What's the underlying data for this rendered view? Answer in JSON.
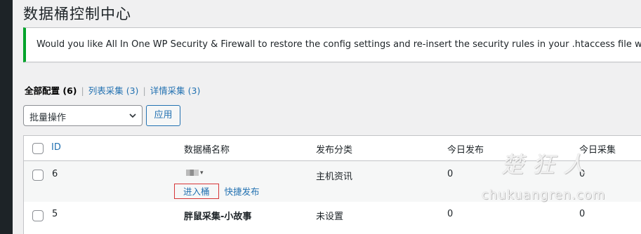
{
  "page": {
    "title": "数据桶控制中心"
  },
  "notice": {
    "text": "Would you like All In One WP Security & Firewall to restore the config settings and re-insert the security rules in your .htaccess file which w"
  },
  "filters": {
    "all_label": "全部配置",
    "all_count": "(6)",
    "list_label": "列表采集",
    "list_count": "(3)",
    "detail_label": "详情采集",
    "detail_count": "(3)",
    "separator": "|"
  },
  "bulk": {
    "selected": "批量操作",
    "apply_label": "应用"
  },
  "table": {
    "columns": {
      "id": "ID",
      "name": "数据桶名称",
      "category": "发布分类",
      "today_publish": "今日发布",
      "today_collect": "今日采集"
    },
    "rows": [
      {
        "id": "6",
        "name": "",
        "category": "主机资讯",
        "today_publish": "0",
        "today_collect": "0",
        "action_enter": "进入桶",
        "action_publish": "快捷发布"
      },
      {
        "id": "5",
        "name": "胖鼠采集-小故事",
        "category": "未设置",
        "today_publish": "0",
        "today_collect": "0"
      }
    ]
  },
  "watermark": {
    "cn": "楚狂人",
    "en": "chukuangren.com"
  },
  "colors": {
    "accent": "#2271b1",
    "notice_border": "#00a32a",
    "highlight_box": "#d63638"
  }
}
